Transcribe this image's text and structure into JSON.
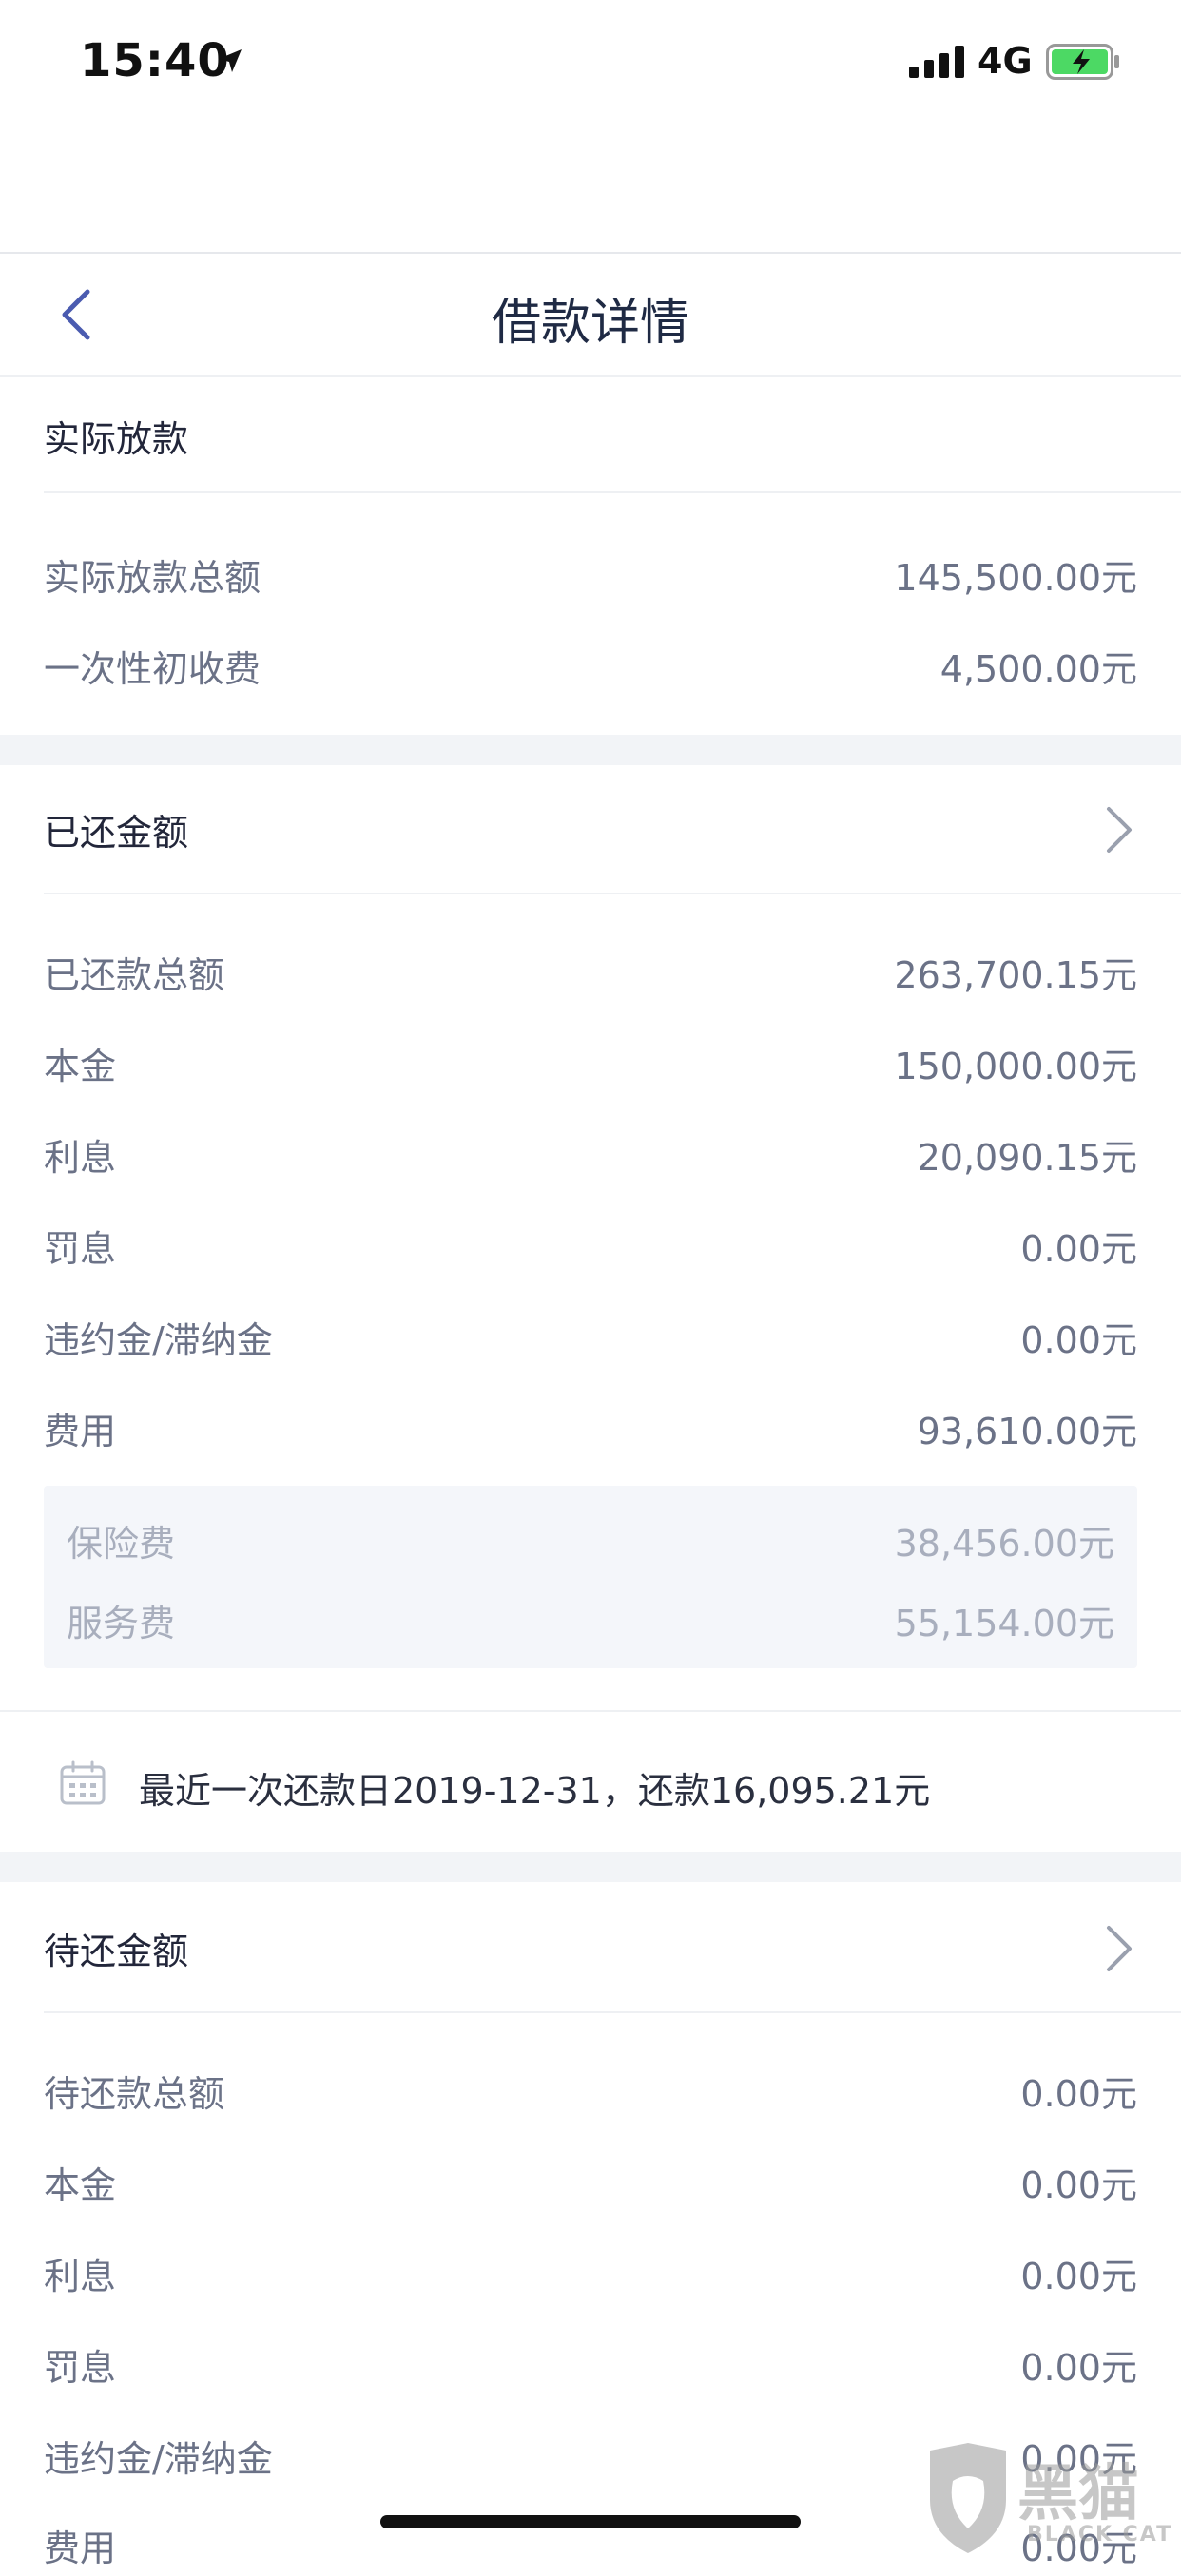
{
  "status_bar": {
    "time": "15:40",
    "network": "4G"
  },
  "header": {
    "title": "借款详情"
  },
  "actual_loan": {
    "title": "实际放款",
    "rows": [
      {
        "label": "实际放款总额",
        "value": "145,500.00元"
      },
      {
        "label": "一次性初收费",
        "value": "4,500.00元"
      }
    ]
  },
  "repaid": {
    "title": "已还金额",
    "rows": [
      {
        "label": "已还款总额",
        "value": "263,700.15元"
      },
      {
        "label": "本金",
        "value": "150,000.00元"
      },
      {
        "label": "利息",
        "value": "20,090.15元"
      },
      {
        "label": "罚息",
        "value": "0.00元"
      },
      {
        "label": "违约金/滞纳金",
        "value": "0.00元"
      },
      {
        "label": "费用",
        "value": "93,610.00元"
      }
    ],
    "fees": [
      {
        "label": "保险费",
        "value": "38,456.00元"
      },
      {
        "label": "服务费",
        "value": "55,154.00元"
      }
    ],
    "notice": "最近一次还款日2019-12-31，还款16,095.21元"
  },
  "pending": {
    "title": "待还金额",
    "rows": [
      {
        "label": "待还款总额",
        "value": "0.00元"
      },
      {
        "label": "本金",
        "value": "0.00元"
      },
      {
        "label": "利息",
        "value": "0.00元"
      },
      {
        "label": "罚息",
        "value": "0.00元"
      },
      {
        "label": "违约金/滞纳金",
        "value": "0.00元"
      },
      {
        "label": "费用",
        "value": "0.00元"
      }
    ]
  },
  "watermark": {
    "text": "黑猫",
    "sub": "BLACK CAT"
  },
  "colors": {
    "title": "#1f2a44",
    "label": "#6b7287",
    "sub_label": "#a8aebd",
    "separator": "#f2f4f7",
    "accent": "#4a5bb0"
  }
}
